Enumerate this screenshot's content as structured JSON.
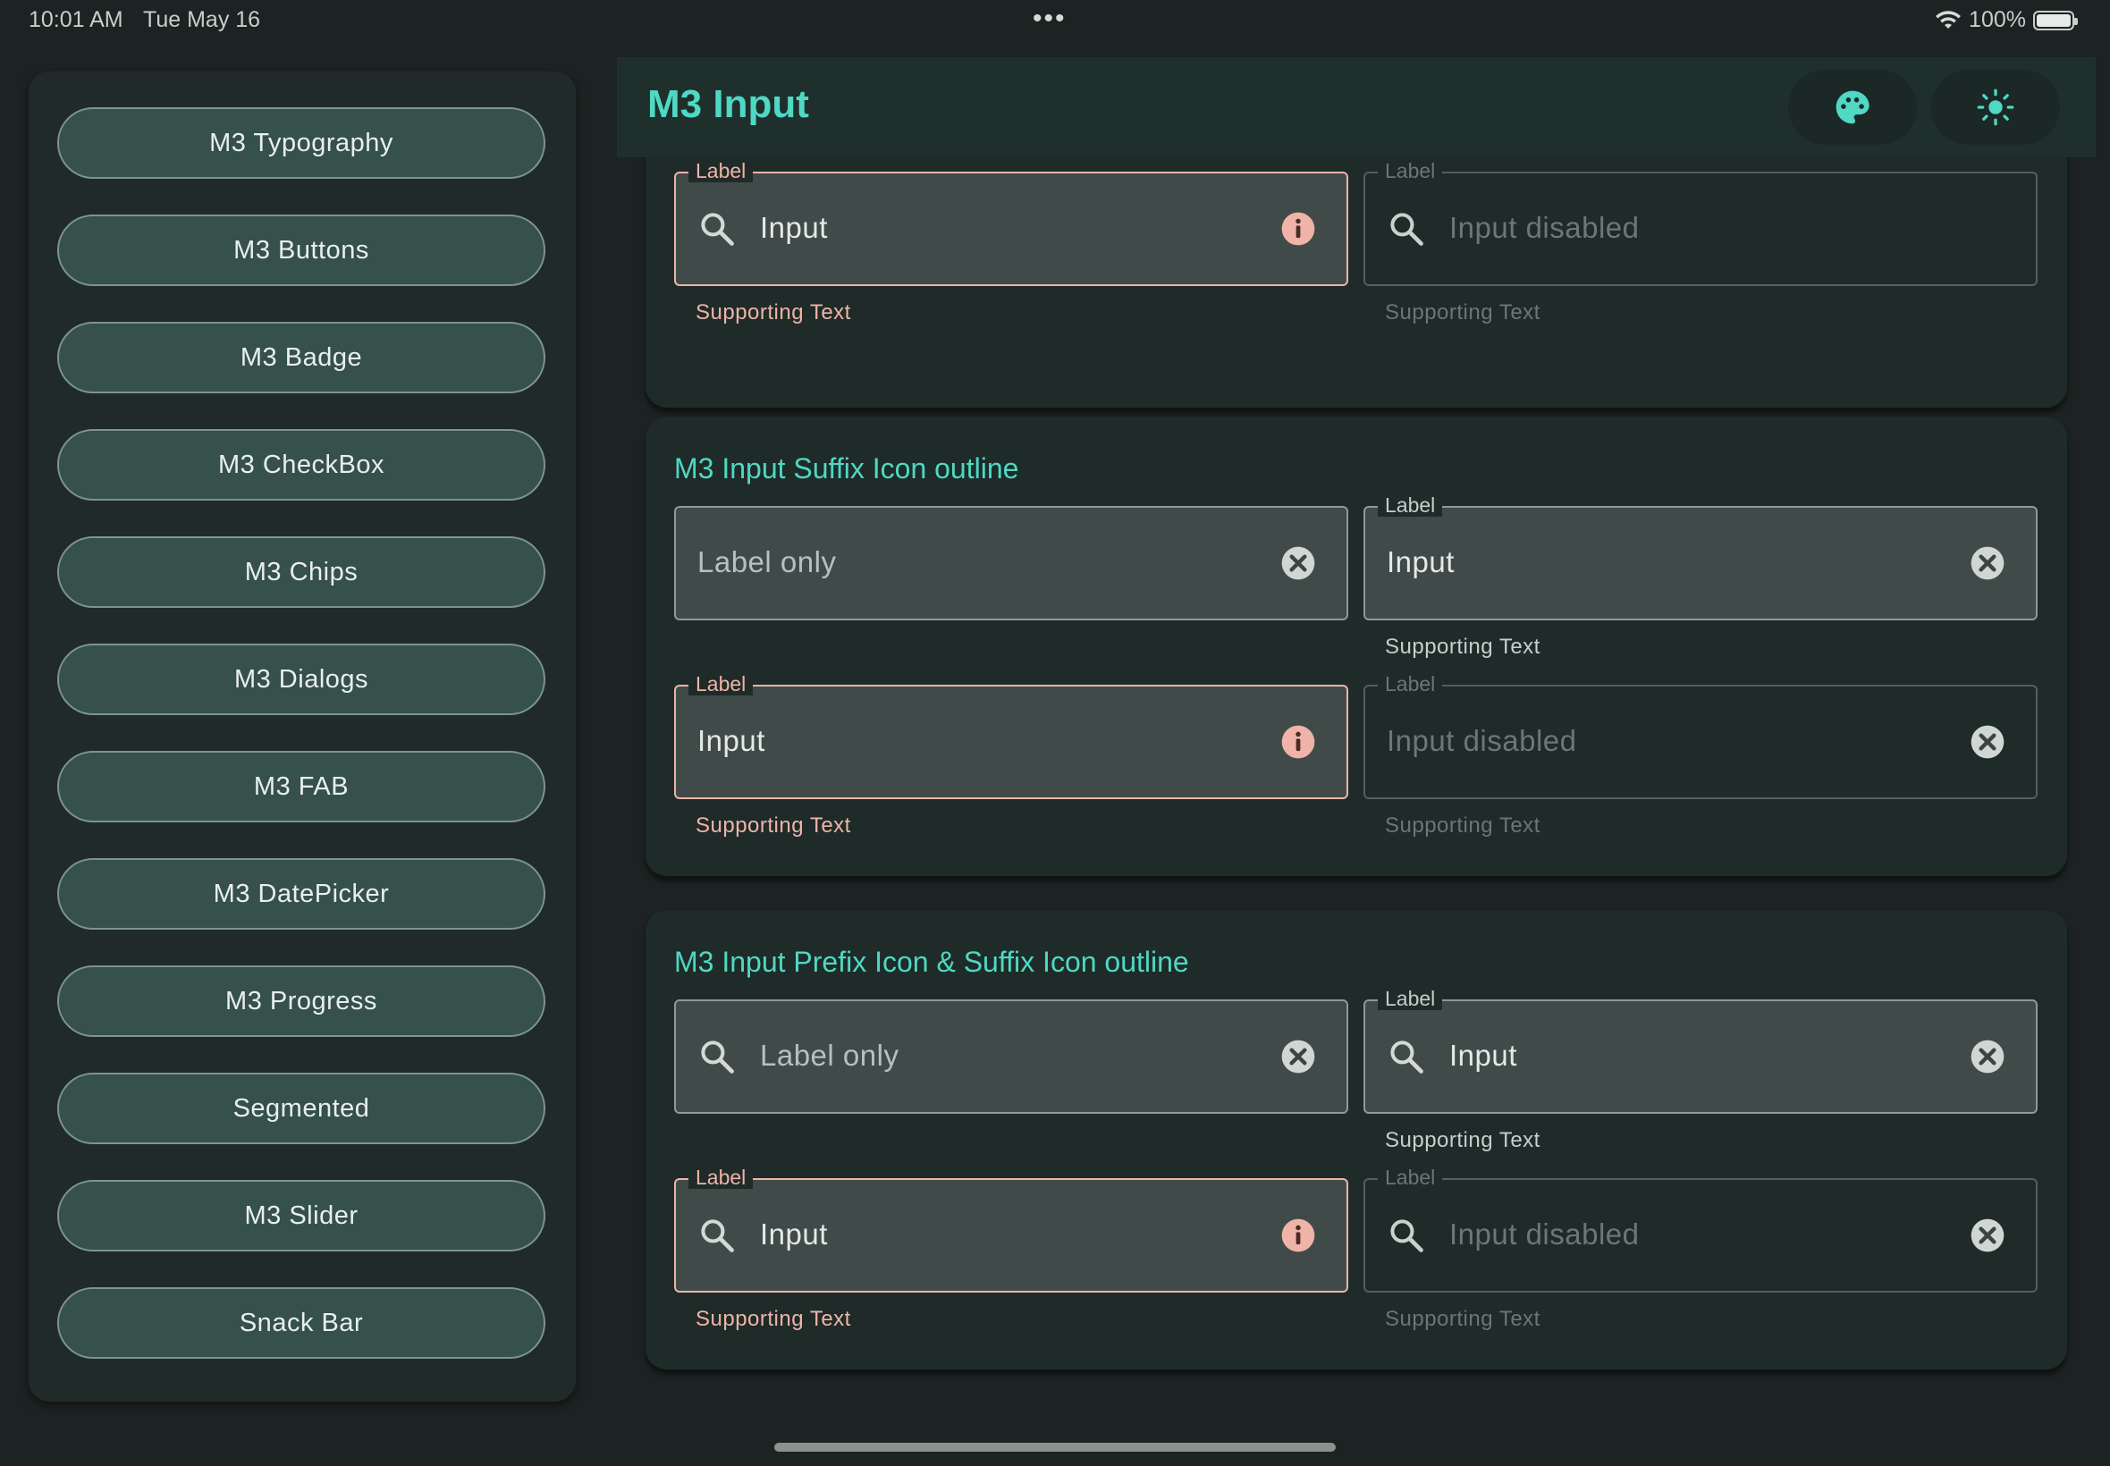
{
  "status_bar": {
    "time": "10:01 AM",
    "date": "Tue May 16",
    "battery": "100%",
    "battery_level": 1.0
  },
  "sidebar": {
    "items": [
      {
        "label": "M3 Typography"
      },
      {
        "label": "M3 Buttons"
      },
      {
        "label": "M3 Badge"
      },
      {
        "label": "M3 CheckBox"
      },
      {
        "label": "M3 Chips"
      },
      {
        "label": "M3 Dialogs"
      },
      {
        "label": "M3 FAB"
      },
      {
        "label": "M3 DatePicker"
      },
      {
        "label": "M3 Progress"
      },
      {
        "label": "Segmented"
      },
      {
        "label": "M3 Slider"
      },
      {
        "label": "Snack Bar"
      }
    ]
  },
  "app_bar": {
    "title": "M3 Input",
    "actions": [
      {
        "icon": "palette-icon"
      },
      {
        "icon": "sun-icon"
      }
    ]
  },
  "cards": [
    {
      "title": "",
      "fields": [
        {
          "label": "Label",
          "value": "Input",
          "prefix_icon": "search-icon",
          "suffix_icon": "info-icon",
          "state": "error",
          "supporting": "Supporting Text"
        },
        {
          "label": "Label",
          "value": "Input disabled",
          "prefix_icon": "search-icon",
          "suffix_icon": "",
          "state": "disabled",
          "supporting": "Supporting Text"
        }
      ]
    },
    {
      "title": "M3 Input Suffix Icon outline",
      "fields": [
        {
          "label": "",
          "value": "Label only",
          "prefix_icon": "",
          "suffix_icon": "clear-icon",
          "state": "normal",
          "supporting": ""
        },
        {
          "label": "Label",
          "value": "Input",
          "prefix_icon": "",
          "suffix_icon": "clear-icon",
          "state": "normal",
          "supporting": "Supporting Text"
        },
        {
          "label": "Label",
          "value": "Input",
          "prefix_icon": "",
          "suffix_icon": "info-icon",
          "state": "error",
          "supporting": "Supporting Text"
        },
        {
          "label": "Label",
          "value": "Input disabled",
          "prefix_icon": "",
          "suffix_icon": "clear-icon",
          "state": "disabled",
          "supporting": "Supporting Text"
        }
      ]
    },
    {
      "title": "M3 Input Prefix Icon & Suffix Icon outline",
      "fields": [
        {
          "label": "",
          "value": "Label only",
          "prefix_icon": "search-icon",
          "suffix_icon": "clear-icon",
          "state": "normal",
          "supporting": ""
        },
        {
          "label": "Label",
          "value": "Input",
          "prefix_icon": "search-icon",
          "suffix_icon": "clear-icon",
          "state": "normal",
          "supporting": "Supporting Text"
        },
        {
          "label": "Label",
          "value": "Input",
          "prefix_icon": "search-icon",
          "suffix_icon": "info-icon",
          "state": "error",
          "supporting": "Supporting Text"
        },
        {
          "label": "Label",
          "value": "Input disabled",
          "prefix_icon": "search-icon",
          "suffix_icon": "clear-icon",
          "state": "disabled",
          "supporting": "Supporting Text"
        }
      ]
    }
  ],
  "colors": {
    "background": "#1c2322",
    "surface": "#202b29",
    "primary": "#4fd8c3",
    "error": "#f0b3a7",
    "nav_button": "#36504b"
  }
}
